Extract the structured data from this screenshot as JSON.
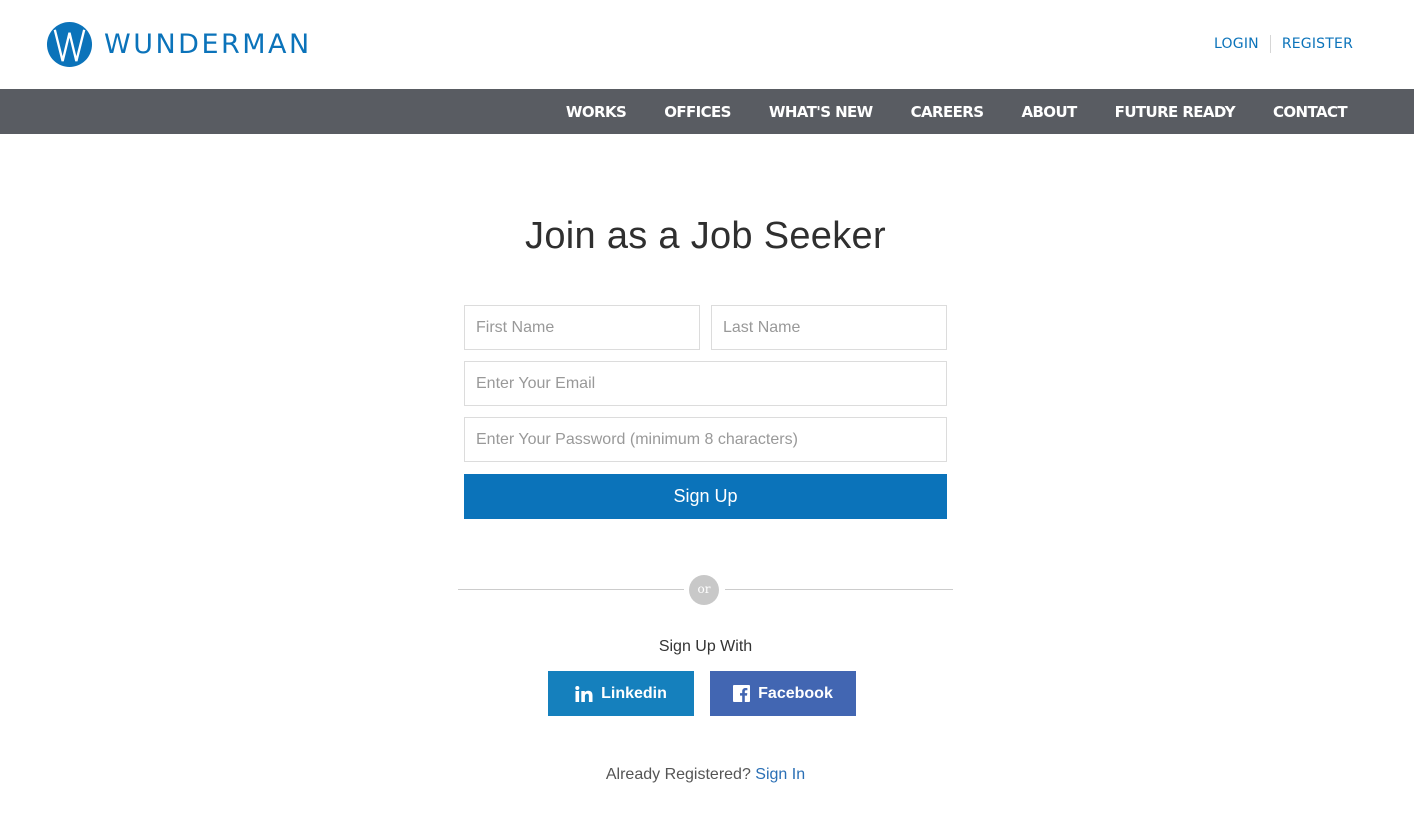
{
  "header": {
    "brand": "WUNDERMAN",
    "login_label": "LOGIN",
    "register_label": "REGISTER"
  },
  "nav": {
    "items": [
      "WORKS",
      "OFFICES",
      "WHAT'S NEW",
      "CAREERS",
      "ABOUT",
      "FUTURE READY",
      "CONTACT"
    ]
  },
  "form": {
    "title": "Join as a Job Seeker",
    "first_name_placeholder": "First Name",
    "last_name_placeholder": "Last Name",
    "email_placeholder": "Enter Your Email",
    "password_placeholder": "Enter Your Password (minimum 8 characters)",
    "submit_label": "Sign Up"
  },
  "divider": {
    "label": "or"
  },
  "social": {
    "heading": "Sign Up With",
    "linkedin_label": "Linkedin",
    "facebook_label": "Facebook",
    "linkedin_icon": "linkedin-icon",
    "facebook_icon": "facebook-icon"
  },
  "footer": {
    "already_text": "Already Registered?",
    "signin_label": "Sign In"
  },
  "colors": {
    "brand_blue": "#0b73ba",
    "nav_bg": "#595c62",
    "linkedin": "#1580bd",
    "facebook": "#4266b2"
  }
}
